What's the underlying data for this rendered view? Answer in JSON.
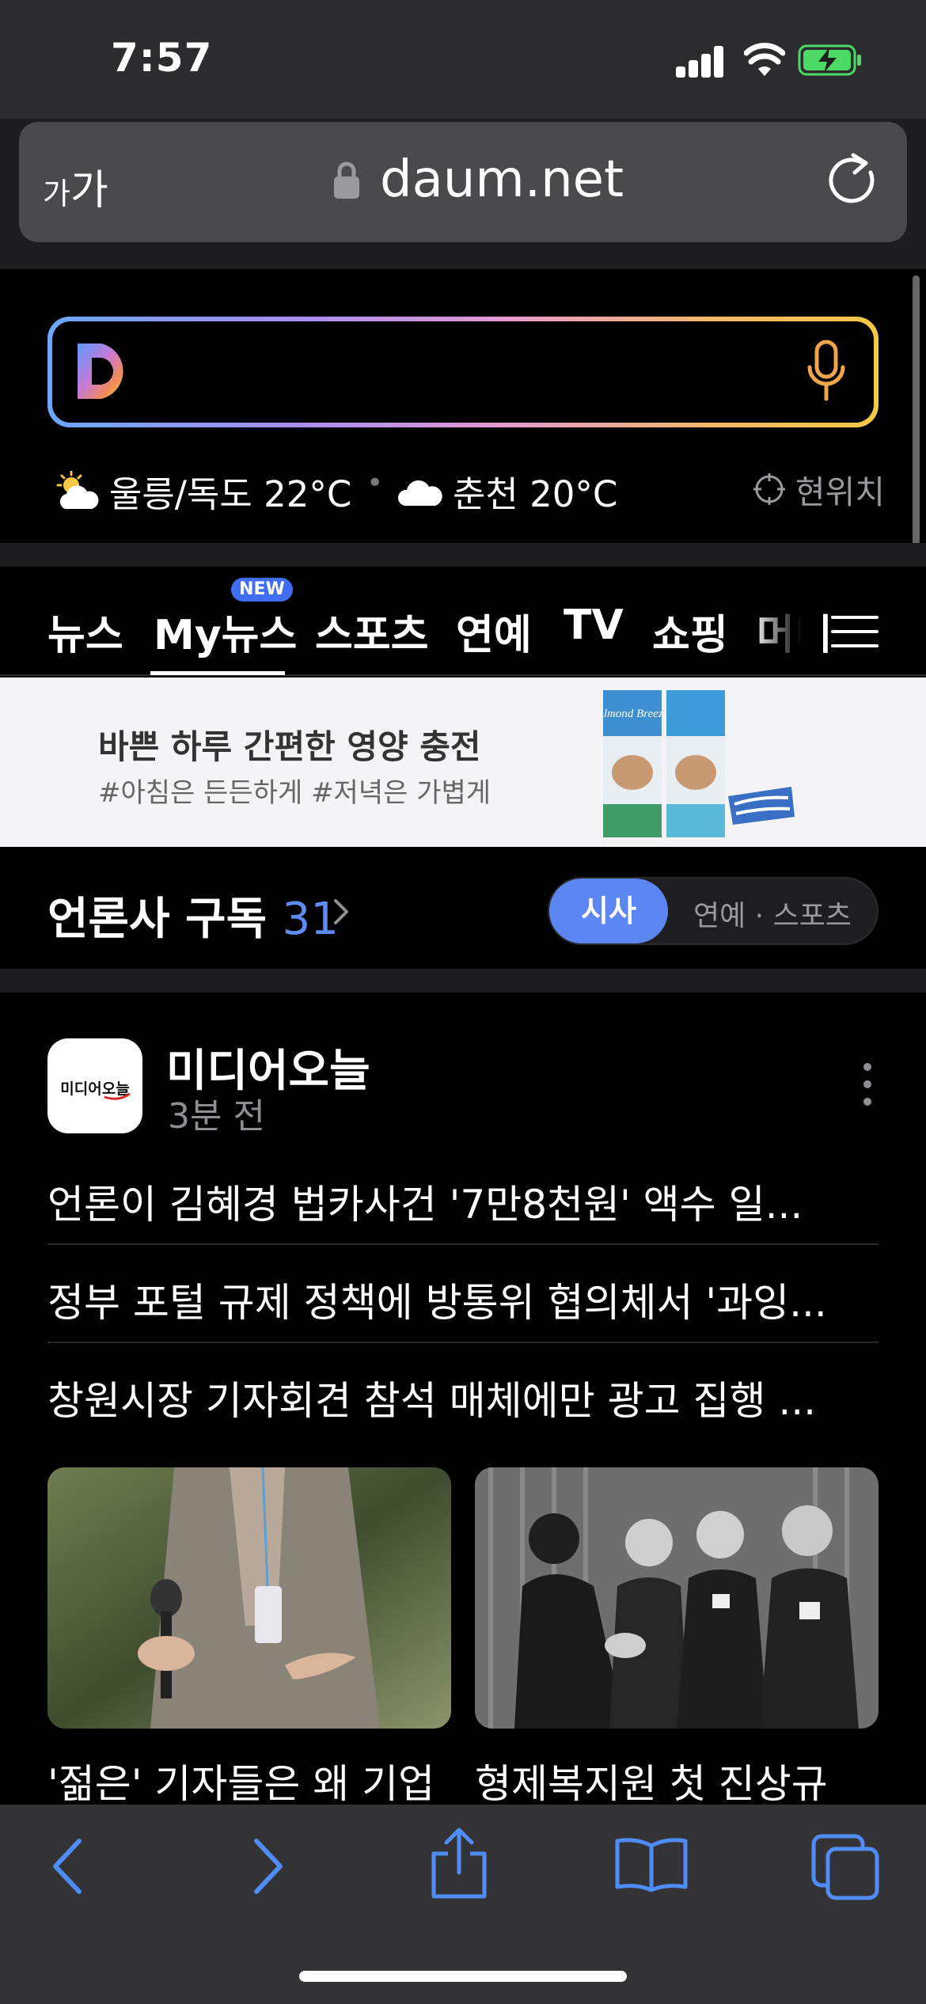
{
  "status_bar": {
    "time": "7:57"
  },
  "url_bar": {
    "text_size_label_small": "가",
    "text_size_label_large": "가",
    "url": "daum.net"
  },
  "search": {
    "logo_letter": "D"
  },
  "weather": {
    "location1": "울릉/독도 22°C",
    "separator": "•",
    "location2": "춘천 20°C",
    "current_location": "현위치"
  },
  "tabs": {
    "badge": "NEW",
    "items": [
      "뉴스",
      "My뉴스",
      "스포츠",
      "연예",
      "TV",
      "쇼핑",
      "머니"
    ],
    "active": "My뉴스"
  },
  "ad": {
    "title": "바쁜 하루 간편한 영양 충전",
    "subtitle": "#아침은 든든하게 #저녁은 가볍게",
    "brand": "Almond Breeze"
  },
  "press": {
    "title": "언론사 구독",
    "count": "31",
    "toggle_active": "시사",
    "toggle_inactive": "연예 · 스포츠"
  },
  "card": {
    "media_name": "미디어오늘",
    "media_logo_text": "미디어오늘",
    "time": "3분 전",
    "headlines": [
      "언론이 김혜경 법카사건 '7만8천원' 액수 일...",
      "정부 포털 규제 정책에 방통위 협의체서 '과잉...",
      "창원시장 기자회견 참석 매체에만 광고 집행 ..."
    ],
    "photos": [
      {
        "caption": "'젊은' 기자들은 왜 기업"
      },
      {
        "caption": "형제복지원 첫 진상규"
      }
    ]
  },
  "colors": {
    "accent_blue": "#5c86f2",
    "page_bg": "#000000",
    "chrome_bg": "#2c2c2e",
    "toolbar_icon": "#4f8cf7",
    "battery_green": "#4cd964"
  },
  "icons": [
    "lock-icon",
    "reload-icon",
    "mic-icon",
    "sun-cloud-icon",
    "cloud-icon",
    "location-icon",
    "menu-icon",
    "chevron-right-icon",
    "more-icon",
    "back-icon",
    "forward-icon",
    "share-icon",
    "bookmarks-icon",
    "tabs-icon"
  ]
}
